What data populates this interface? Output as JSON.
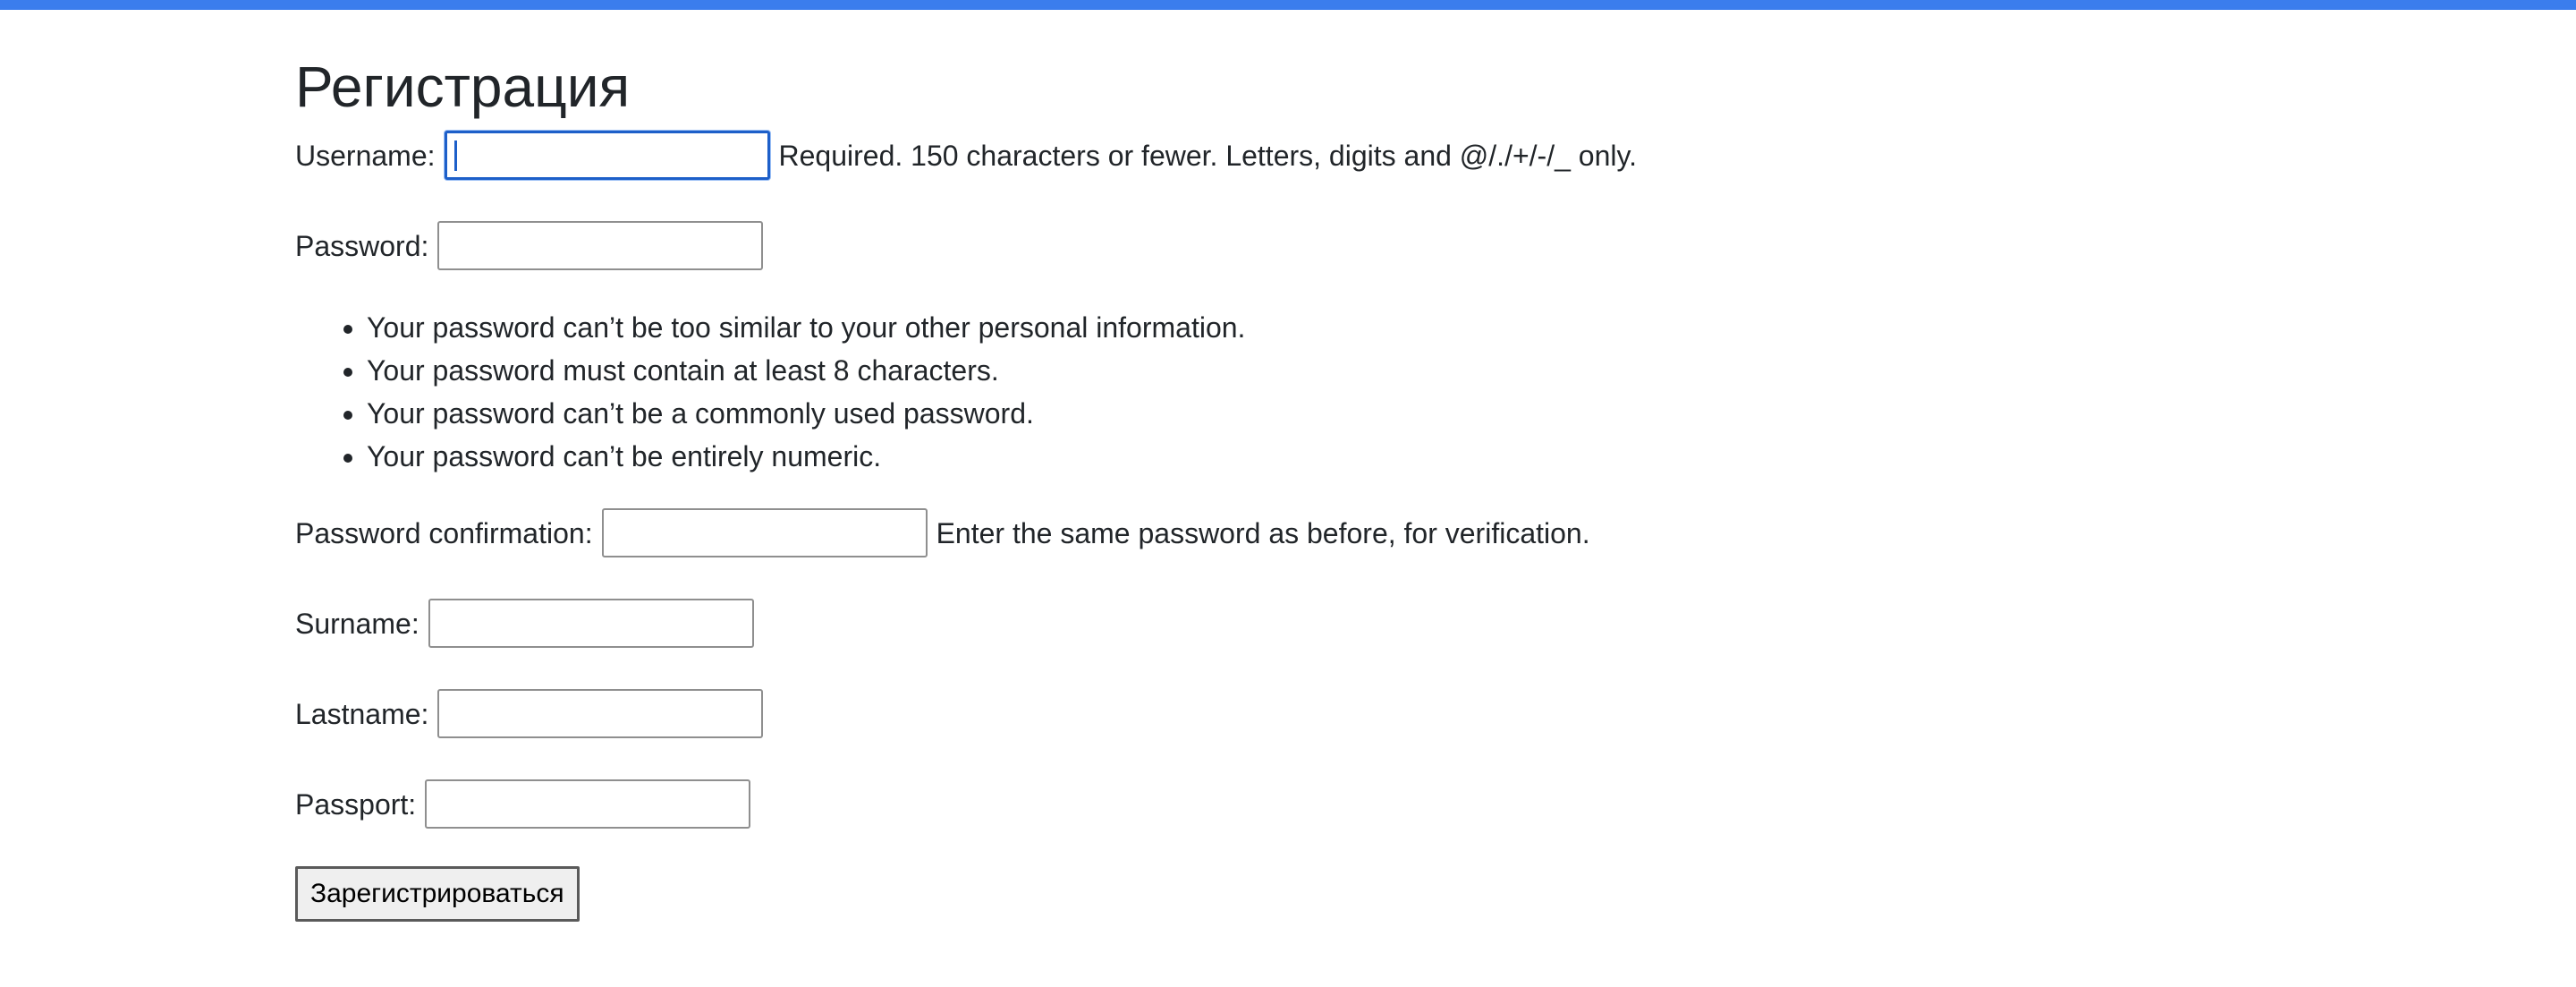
{
  "header": {
    "accent_color": "#3b7ded"
  },
  "page": {
    "title": "Регистрация"
  },
  "form": {
    "username": {
      "label": "Username:",
      "value": "",
      "help": "Required. 150 characters or fewer. Letters, digits and @/./+/-/_ only."
    },
    "password": {
      "label": "Password:",
      "value": "",
      "rules": [
        "Your password can’t be too similar to your other personal information.",
        "Your password must contain at least 8 characters.",
        "Your password can’t be a commonly used password.",
        "Your password can’t be entirely numeric."
      ]
    },
    "password_confirmation": {
      "label": "Password confirmation:",
      "value": "",
      "help": "Enter the same password as before, for verification."
    },
    "surname": {
      "label": "Surname:",
      "value": ""
    },
    "lastname": {
      "label": "Lastname:",
      "value": ""
    },
    "passport": {
      "label": "Passport:",
      "value": ""
    },
    "submit_label": "Зарегистрироваться"
  }
}
